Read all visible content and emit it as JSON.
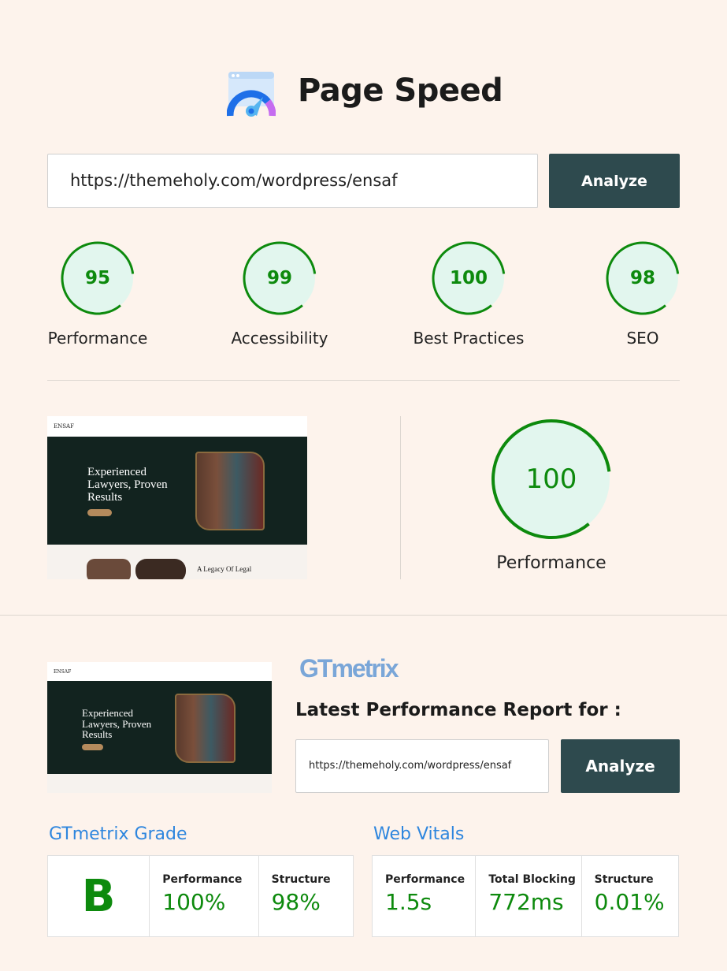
{
  "header": {
    "title": "Page Speed",
    "icon": "speedometer-browser-icon"
  },
  "pagespeed": {
    "url": "https://themeholy.com/wordpress/ensaf",
    "analyze_label": "Analyze",
    "scores": [
      {
        "label": "Performance",
        "value": "95"
      },
      {
        "label": "Accessibility",
        "value": "99"
      },
      {
        "label": "Best Practices",
        "value": "100"
      },
      {
        "label": "SEO",
        "value": "98"
      }
    ],
    "main_score": {
      "label": "Performance",
      "value": "100"
    }
  },
  "preview": {
    "logo": "ENSAF",
    "headline": "Experienced Lawyers, Proven Results",
    "section": "A Legacy Of Legal"
  },
  "gtmetrix": {
    "logo": "GTmetrix",
    "report_title": "Latest Performance Report for :",
    "url": "https://themeholy.com/wordpress/ensaf",
    "analyze_label": "Analyze",
    "grade_title": "GTmetrix Grade",
    "grade": "B",
    "grade_metrics": [
      {
        "label": "Performance",
        "value": "100%"
      },
      {
        "label": "Structure",
        "value": "98%"
      }
    ],
    "vitals_title": "Web Vitals",
    "vitals": [
      {
        "label": "Performance",
        "value": "1.5s"
      },
      {
        "label": "Total Blocking",
        "value": "772ms"
      },
      {
        "label": "Structure",
        "value": "0.01%"
      }
    ]
  },
  "colors": {
    "accent_green": "#0d8a0d",
    "button": "#2e4a4e",
    "link_blue": "#2e86de",
    "background": "#fdf3ec"
  }
}
